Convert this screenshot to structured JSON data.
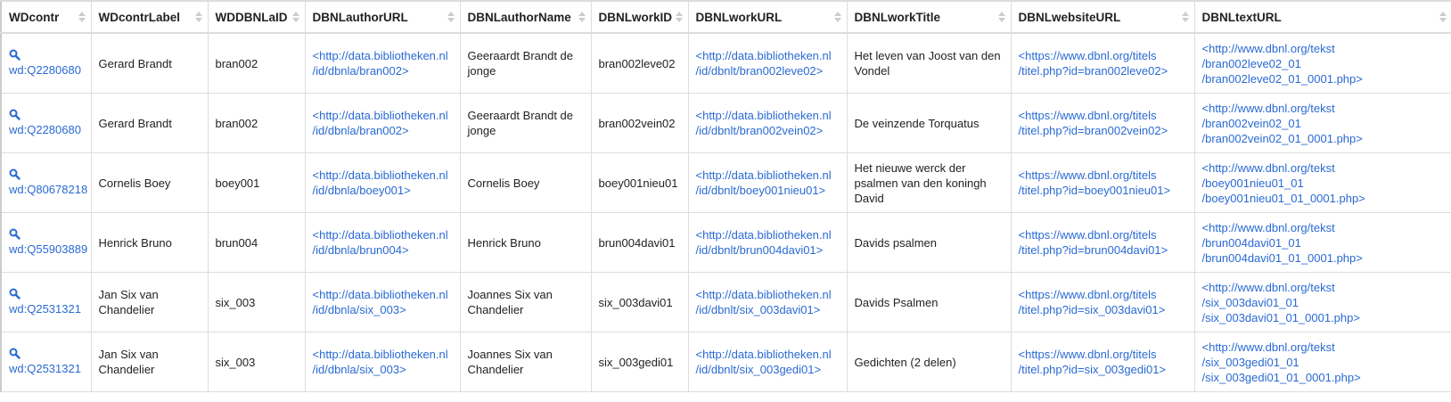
{
  "colors": {
    "link": "#2a6ad3",
    "border": "#dddddd"
  },
  "headers": [
    "WDcontr",
    "WDcontrLabel",
    "WDDBNLaID",
    "DBNLauthorURL",
    "DBNLauthorName",
    "DBNLworkID",
    "DBNLworkURL",
    "DBNLworkTitle",
    "DBNLwebsiteURL",
    "DBNLtextURL"
  ],
  "rows": [
    {
      "wd": [
        "wd:Q2280680"
      ],
      "label": [
        "Gerard Brandt"
      ],
      "aid": [
        "bran002"
      ],
      "authorurl": [
        "<http://data.bibliotheken.nl",
        "/id/dbnla/bran002>"
      ],
      "authorname": [
        "Geeraardt Brandt de",
        "jonge"
      ],
      "workid": [
        "bran002leve02"
      ],
      "workurl": [
        "<http://data.bibliotheken.nl",
        "/id/dbnlt/bran002leve02>"
      ],
      "title": [
        "Het leven van Joost van den",
        "Vondel"
      ],
      "website": [
        "<https://www.dbnl.org/titels",
        "/titel.php?id=bran002leve02>"
      ],
      "text": [
        "<http://www.dbnl.org/tekst",
        "/bran002leve02_01",
        "/bran002leve02_01_0001.php>"
      ]
    },
    {
      "wd": [
        "wd:Q2280680"
      ],
      "label": [
        "Gerard Brandt"
      ],
      "aid": [
        "bran002"
      ],
      "authorurl": [
        "<http://data.bibliotheken.nl",
        "/id/dbnla/bran002>"
      ],
      "authorname": [
        "Geeraardt Brandt de",
        "jonge"
      ],
      "workid": [
        "bran002vein02"
      ],
      "workurl": [
        "<http://data.bibliotheken.nl",
        "/id/dbnlt/bran002vein02>"
      ],
      "title": [
        "De veinzende Torquatus"
      ],
      "website": [
        "<https://www.dbnl.org/titels",
        "/titel.php?id=bran002vein02>"
      ],
      "text": [
        "<http://www.dbnl.org/tekst",
        "/bran002vein02_01",
        "/bran002vein02_01_0001.php>"
      ]
    },
    {
      "wd": [
        "wd:Q80678218"
      ],
      "label": [
        "Cornelis Boey"
      ],
      "aid": [
        "boey001"
      ],
      "authorurl": [
        "<http://data.bibliotheken.nl",
        "/id/dbnla/boey001>"
      ],
      "authorname": [
        "Cornelis Boey"
      ],
      "workid": [
        "boey001nieu01"
      ],
      "workurl": [
        "<http://data.bibliotheken.nl",
        "/id/dbnlt/boey001nieu01>"
      ],
      "title": [
        "Het nieuwe werck der",
        "psalmen van den koningh",
        "David"
      ],
      "website": [
        "<https://www.dbnl.org/titels",
        "/titel.php?id=boey001nieu01>"
      ],
      "text": [
        "<http://www.dbnl.org/tekst",
        "/boey001nieu01_01",
        "/boey001nieu01_01_0001.php>"
      ]
    },
    {
      "wd": [
        "wd:Q55903889"
      ],
      "label": [
        "Henrick Bruno"
      ],
      "aid": [
        "brun004"
      ],
      "authorurl": [
        "<http://data.bibliotheken.nl",
        "/id/dbnla/brun004>"
      ],
      "authorname": [
        "Henrick Bruno"
      ],
      "workid": [
        "brun004davi01"
      ],
      "workurl": [
        "<http://data.bibliotheken.nl",
        "/id/dbnlt/brun004davi01>"
      ],
      "title": [
        "Davids psalmen"
      ],
      "website": [
        "<https://www.dbnl.org/titels",
        "/titel.php?id=brun004davi01>"
      ],
      "text": [
        "<http://www.dbnl.org/tekst",
        "/brun004davi01_01",
        "/brun004davi01_01_0001.php>"
      ]
    },
    {
      "wd": [
        "wd:Q2531321"
      ],
      "label": [
        "Jan Six van",
        "Chandelier"
      ],
      "aid": [
        "six_003"
      ],
      "authorurl": [
        "<http://data.bibliotheken.nl",
        "/id/dbnla/six_003>"
      ],
      "authorname": [
        "Joannes Six van",
        "Chandelier"
      ],
      "workid": [
        "six_003davi01"
      ],
      "workurl": [
        "<http://data.bibliotheken.nl",
        "/id/dbnlt/six_003davi01>"
      ],
      "title": [
        "Davids Psalmen"
      ],
      "website": [
        "<https://www.dbnl.org/titels",
        "/titel.php?id=six_003davi01>"
      ],
      "text": [
        "<http://www.dbnl.org/tekst",
        "/six_003davi01_01",
        "/six_003davi01_01_0001.php>"
      ]
    },
    {
      "wd": [
        "wd:Q2531321"
      ],
      "label": [
        "Jan Six van",
        "Chandelier"
      ],
      "aid": [
        "six_003"
      ],
      "authorurl": [
        "<http://data.bibliotheken.nl",
        "/id/dbnla/six_003>"
      ],
      "authorname": [
        "Joannes Six van",
        "Chandelier"
      ],
      "workid": [
        "six_003gedi01"
      ],
      "workurl": [
        "<http://data.bibliotheken.nl",
        "/id/dbnlt/six_003gedi01>"
      ],
      "title": [
        "Gedichten (2 delen)"
      ],
      "website": [
        "<https://www.dbnl.org/titels",
        "/titel.php?id=six_003gedi01>"
      ],
      "text": [
        "<http://www.dbnl.org/tekst",
        "/six_003gedi01_01",
        "/six_003gedi01_01_0001.php>"
      ]
    }
  ]
}
